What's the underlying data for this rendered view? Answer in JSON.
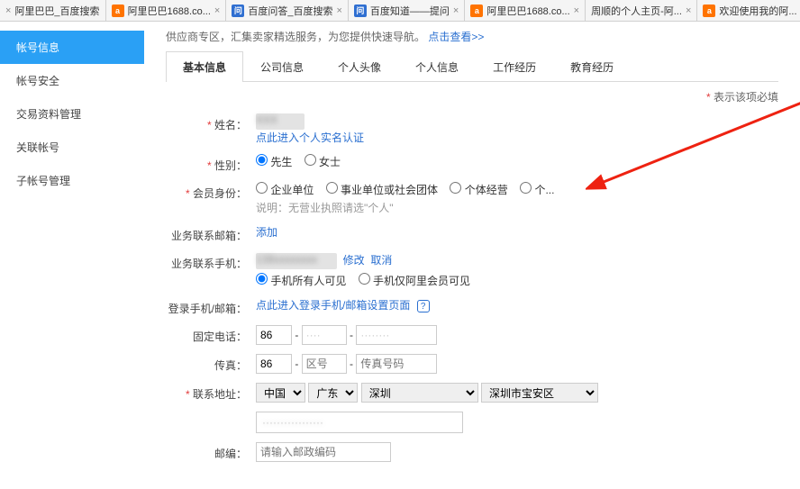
{
  "browser_tabs": [
    {
      "title": "阿里巴巴_百度搜索",
      "icon": ""
    },
    {
      "title": "阿里巴巴1688.co...",
      "icon": "orange"
    },
    {
      "title": "百度问答_百度搜索",
      "icon": "blue"
    },
    {
      "title": "百度知道——提问",
      "icon": "blue"
    },
    {
      "title": "阿里巴巴1688.co...",
      "icon": "orange"
    },
    {
      "title": "周顺的个人主页-阿...",
      "icon": ""
    },
    {
      "title": "欢迎使用我的阿...",
      "icon": "orange"
    }
  ],
  "sidebar": {
    "items": [
      {
        "label": "帐号信息",
        "active": true
      },
      {
        "label": "帐号安全"
      },
      {
        "label": "交易资料管理"
      },
      {
        "label": "关联帐号"
      },
      {
        "label": "子帐号管理"
      }
    ]
  },
  "tip": {
    "text": "供应商专区，汇集卖家精选服务，为您提供快速导航。",
    "link": "点击查看>>"
  },
  "nav_tabs": [
    {
      "label": "基本信息",
      "active": true
    },
    {
      "label": "公司信息"
    },
    {
      "label": "个人头像"
    },
    {
      "label": "个人信息"
    },
    {
      "label": "工作经历"
    },
    {
      "label": "教育经历"
    }
  ],
  "required_note": "表示该项必填",
  "form": {
    "name": {
      "label": "姓名",
      "link": "点此进入个人实名认证"
    },
    "gender": {
      "label": "性别",
      "options": [
        "先生",
        "女士"
      ],
      "selected": "先生"
    },
    "member": {
      "label": "会员身份",
      "options": [
        "企业单位",
        "事业单位或社会团体",
        "个体经营",
        "个..."
      ],
      "hint_prefix": "说明：",
      "hint": "无营业执照请选\"个人\""
    },
    "biz_email": {
      "label": "业务联系邮箱",
      "action": "添加"
    },
    "biz_phone": {
      "label": "业务联系手机",
      "actions": {
        "edit": "修改",
        "cancel": "取消"
      },
      "visibility": [
        "手机所有人可见",
        "手机仅阿里会员可见"
      ],
      "visibility_selected": "手机所有人可见"
    },
    "login_phone": {
      "label": "登录手机/邮箱",
      "link": "点此进入登录手机/邮箱设置页面"
    },
    "landline": {
      "label": "固定电话",
      "cc": "86"
    },
    "fax": {
      "label": "传真",
      "cc": "86",
      "area_ph": "区号",
      "num_ph": "传真号码"
    },
    "address": {
      "label": "联系地址",
      "country": {
        "selected": "中国"
      },
      "province": {
        "selected": "广东"
      },
      "city": {
        "selected": "深圳"
      },
      "district": {
        "selected": "深圳市宝安区"
      }
    },
    "postcode": {
      "label": "邮编",
      "placeholder": "请输入邮政编码"
    }
  }
}
